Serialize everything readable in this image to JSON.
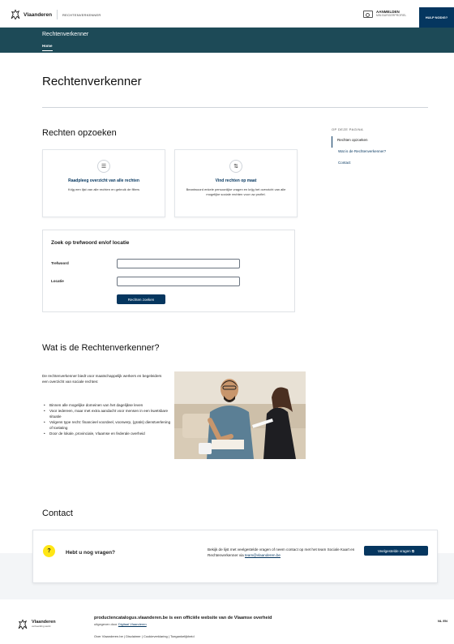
{
  "header": {
    "brand": "Vlaanderen",
    "entity": "RECHTENVERKENNER",
    "login_title": "AANMELDEN",
    "login_sub": "MIN BURGERPROFIEL",
    "help": "HULP NODIG?"
  },
  "nav": {
    "site_title": "Rechtenverkenner",
    "tab": "Home"
  },
  "page_title": "Rechtenverkenner",
  "search_section": {
    "heading": "Rechten opzoeken",
    "cards": [
      {
        "icon": "list-icon",
        "title": "Raadpleeg overzicht van alle rechten",
        "text": "Krijg een lijst van alle rechten en gebruik de filters"
      },
      {
        "icon": "filter-icon",
        "title": "Vind rechten op maat",
        "text": "Beantwoord enkele persoonlijke vragen en krijg het overzicht van alle mogelijke sociale rechten voor uw profiel."
      }
    ],
    "box_title": "Zoek op trefwoord en/of locatie",
    "keyword_label": "Trefwoord",
    "keyword_value": "",
    "location_label": "Locatie",
    "location_value": "",
    "button": "Rechten zoeken"
  },
  "toc": {
    "label": "OP DEZE PAGINA",
    "items": [
      "Rechten opzoeken",
      "Wat is de Rechtenverkenner?",
      "Contact"
    ]
  },
  "about": {
    "heading": "Wat is de Rechtenverkenner?",
    "intro": "De rechtenverkenner biedt voor maatschappelijk werkers en begeleiders een overzicht van sociale rechten:",
    "list": [
      "Binnen alle mogelijke domeinen van het dagelijkse leven",
      "Voor iedereen, maar met extra aandacht voor mensen in een kwetsbare situatie",
      "Volgens type recht: financieel voordeel, voorwerp, (gratis) dienstverlening of toelating",
      "Door de lokale, provinciale, Vlaamse en federale overheid"
    ]
  },
  "contact": {
    "heading": "Contact",
    "question": "Hebt u nog vragen?",
    "text": "Bekijk de lijst met veelgestelde vragen of neem contact op met het team Sociale Kaart en Rechtenverkenner via",
    "email": "team@vlaanderen.be",
    "button": "Veelgestelde vragen"
  },
  "footer": {
    "brand": "Vlaanderen",
    "tagline": "verbeelding werkt",
    "title": "productencatalogus.vlaanderen.be is een officiële website van de Vlaamse overheid",
    "sub_prefix": "uitgegeven door",
    "sub_link": "Digitaal Vlaanderen",
    "links": "Over Vlaanderen.be | Disclaimer | Cookieverklaring | Toegankelijkheid",
    "lang": "NL EN"
  }
}
